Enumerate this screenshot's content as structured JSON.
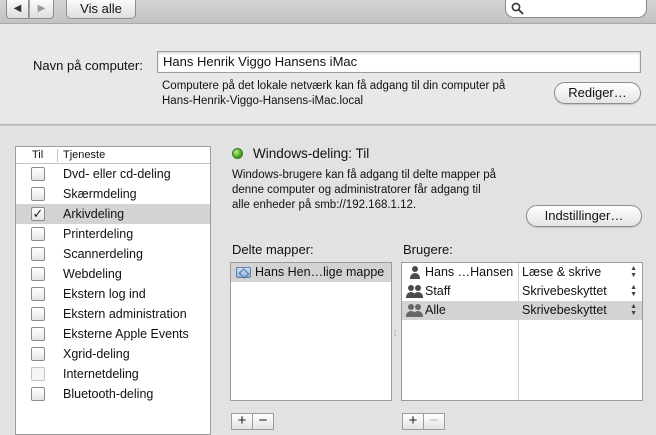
{
  "toolbar": {
    "back_glyph": "◀",
    "forward_glyph": "▶",
    "show_all_label": "Vis alle",
    "search_placeholder": ""
  },
  "computer": {
    "name_label": "Navn på computer:",
    "name_value": "Hans Henrik Viggo Hansens iMac",
    "desc_line1": "Computere på det lokale netværk kan få adgang til din computer på",
    "desc_line2": "Hans-Henrik-Viggo-Hansens-iMac.local",
    "edit_button": "Rediger…"
  },
  "services": {
    "col_on": "Til",
    "col_service": "Tjeneste",
    "items": [
      {
        "label": "Dvd- eller cd-deling",
        "checked": false
      },
      {
        "label": "Skærmdeling",
        "checked": false
      },
      {
        "label": "Arkivdeling",
        "checked": true,
        "selected": true
      },
      {
        "label": "Printerdeling",
        "checked": false
      },
      {
        "label": "Scannerdeling",
        "checked": false
      },
      {
        "label": "Webdeling",
        "checked": false
      },
      {
        "label": "Ekstern log ind",
        "checked": false
      },
      {
        "label": "Ekstern administration",
        "checked": false
      },
      {
        "label": "Eksterne Apple Events",
        "checked": false
      },
      {
        "label": "Xgrid-deling",
        "checked": false
      },
      {
        "label": "Internetdeling",
        "checked": false,
        "dimmed": true
      },
      {
        "label": "Bluetooth-deling",
        "checked": false
      }
    ]
  },
  "detail": {
    "status_label": "Windows-deling: Til",
    "status_color": "#46a81e",
    "desc_line1": "Windows-brugere kan få adgang til delte mapper på",
    "desc_line2": "denne computer og administratorer får adgang til",
    "desc_line3": "alle enheder på smb://192.168.1.12.",
    "options_button": "Indstillinger…",
    "shared_folders_label": "Delte mapper:",
    "users_label": "Brugere:",
    "shared_folders": [
      {
        "name": "Hans Hen…lige mappe"
      }
    ],
    "users": [
      {
        "name": "Hans …Hansen",
        "permission": "Læse & skrive",
        "icon": "single-user-icon"
      },
      {
        "name": "Staff",
        "permission": "Skrivebeskyttet",
        "icon": "group-icon"
      },
      {
        "name": "Alle",
        "permission": "Skrivebeskyttet",
        "icon": "everyone-icon",
        "selected": true
      }
    ],
    "add_glyph": "+",
    "remove_glyph": "−",
    "updown_glyph": "▲▼"
  }
}
